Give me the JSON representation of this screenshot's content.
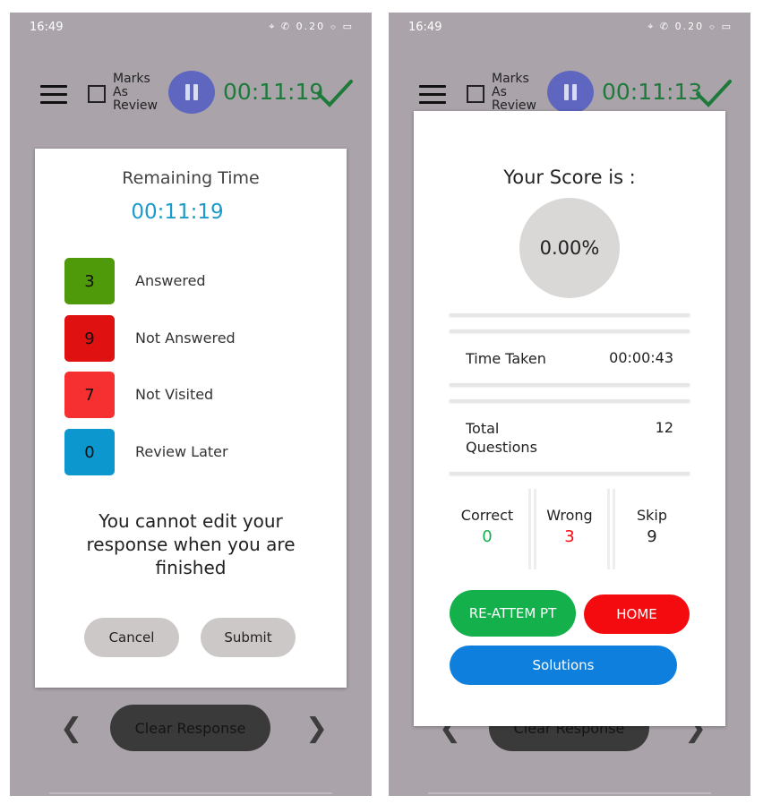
{
  "status_bar": {
    "time": "16:49",
    "icons": "⌖ ✆ 0.20 ⌔ ▭"
  },
  "left": {
    "toolbar": {
      "mark_label": "Marks As Review",
      "timer": "00:11:19"
    },
    "dialog": {
      "title": "Remaining Time",
      "remaining": "00:11:19",
      "statuses": [
        {
          "count": "3",
          "label": "Answered",
          "color": "#4f9a0a"
        },
        {
          "count": "9",
          "label": "Not Answered",
          "color": "#df1111"
        },
        {
          "count": "7",
          "label": "Not Visited",
          "color": "#f63030"
        },
        {
          "count": "0",
          "label": "Review Later",
          "color": "#0c98cf"
        }
      ],
      "message": "You cannot edit your response when you are finished",
      "cancel": "Cancel",
      "submit": "Submit"
    },
    "clear_response": "Clear Response"
  },
  "right": {
    "toolbar": {
      "mark_label": "Marks As Review",
      "timer": "00:11:13"
    },
    "score": {
      "title": "Your Score is :",
      "value": "0.00%",
      "time_taken_label": "Time Taken",
      "time_taken_value": "00:00:43",
      "total_questions_label": "Total Questions",
      "total_questions_value": "12",
      "correct_label": "Correct",
      "correct_value": "0",
      "wrong_label": "Wrong",
      "wrong_value": "3",
      "skip_label": "Skip",
      "skip_value": "9",
      "reattempt": "RE-ATTEM PT",
      "home": "HOME",
      "solutions": "Solutions"
    },
    "clear_response": "Clear Response"
  },
  "colors": {
    "timer": "#1d7a3a",
    "remaining": "#1c9acb",
    "correct": "#13b04b",
    "wrong": "#f40b10",
    "reattempt": "#13b04b",
    "home": "#f40b10",
    "solutions": "#0f7fde"
  }
}
